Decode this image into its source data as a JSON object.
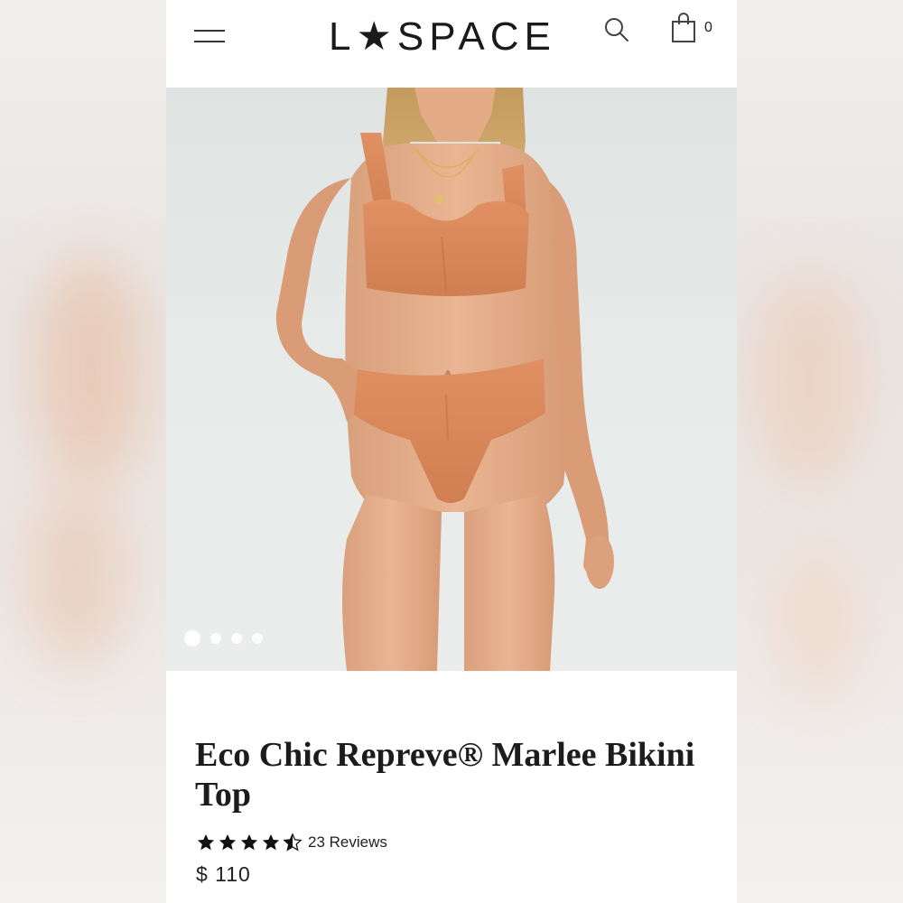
{
  "header": {
    "logo": "L★SPACE",
    "cart_count": "0"
  },
  "icons": {
    "menu": "hamburger-menu-icon",
    "search": "search-icon",
    "cart": "shopping-bag-icon"
  },
  "gallery": {
    "image": "model wearing orange ribbed bikini",
    "slide_count": 4,
    "active_slide": 1
  },
  "product": {
    "title": "Eco Chic Repreve® Marlee Bikini Top",
    "rating": 4.5,
    "reviews_label": "23 Reviews",
    "price": "$ 110"
  },
  "colors": {
    "swimsuit": "#d8895a",
    "text": "#1c1c1c"
  }
}
